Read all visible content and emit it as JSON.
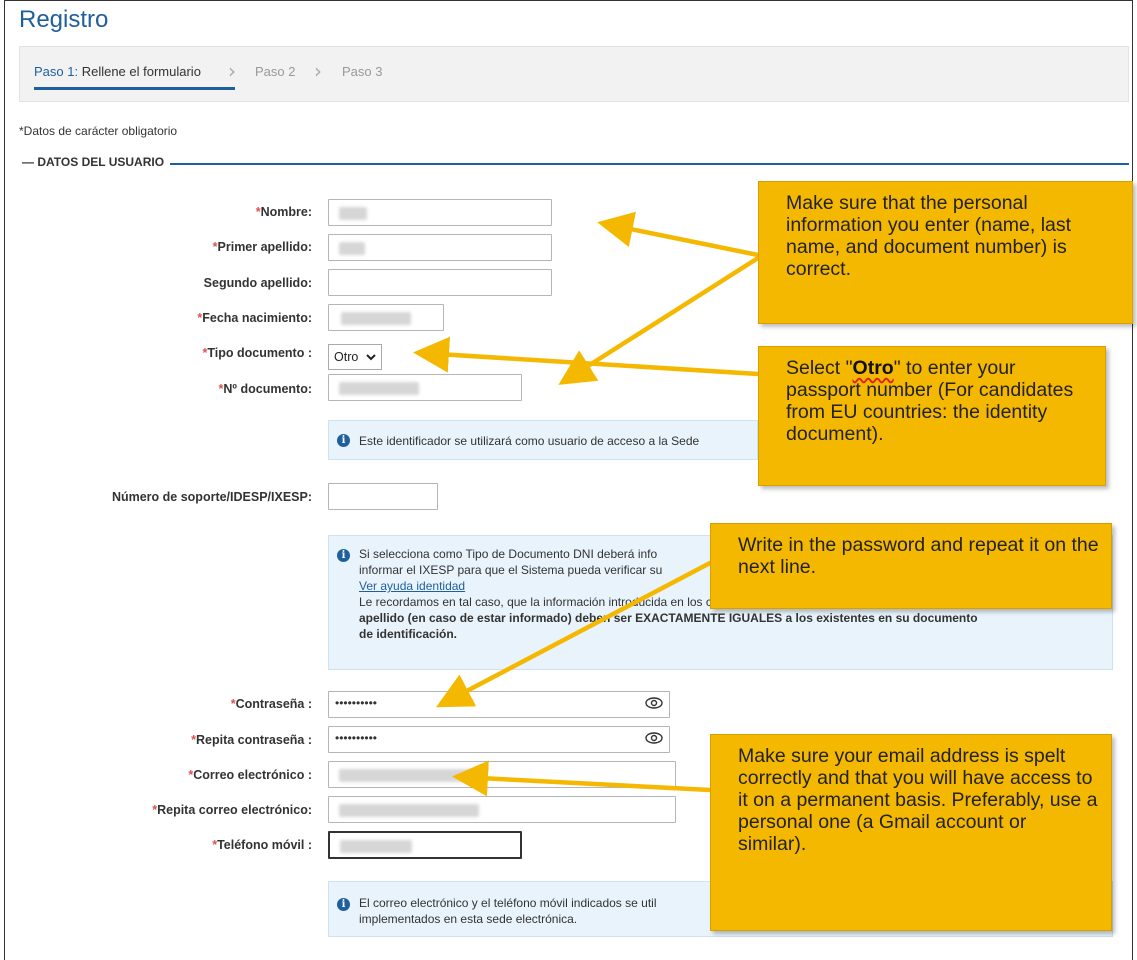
{
  "page": {
    "title": "Registro"
  },
  "stepper": {
    "step1_prefix": "Paso 1:",
    "step1_rest": " Rellene el formulario",
    "step2": "Paso 2",
    "step3": "Paso 3"
  },
  "required_note": "*Datos de carácter obligatorio",
  "section": {
    "legend": "DATOS DEL USUARIO"
  },
  "fields": {
    "nombre": "Nombre:",
    "primer_apellido": "Primer apellido:",
    "segundo_apellido": "Segundo apellido:",
    "fecha_nacimiento": "Fecha nacimiento:",
    "tipo_documento": "Tipo documento :",
    "tipo_documento_value": "Otro",
    "n_documento": "Nº documento:",
    "numero_soporte": "Número de soporte/IDESP/IXESP:",
    "contrasena": "Contraseña :",
    "contrasena_value": "••••••••••",
    "repita_contrasena": "Repita contraseña :",
    "repita_contrasena_value": "••••••••••",
    "correo": "Correo electrónico :",
    "repita_correo": "Repita correo electrónico:",
    "telefono": "Teléfono móvil :"
  },
  "info": {
    "identificador": "Este identificador se utilizará como usuario de acceso a la Sede",
    "dni_line1": "Si selecciona como Tipo de Documento DNI deberá info",
    "dni_line2": "informar el IXESP para que el Sistema pueda verificar su",
    "ayuda_link": "Ver ayuda identidad",
    "recordamos": "Le recordamos en tal caso, que la información introducida en los campos Nombre, Primer apellido y Segundo",
    "apellido_bold": "apellido (en caso de estar informado) deben ser EXACTAMENTE IGUALES a los existentes en su documento",
    "identificacion": "de identificación.",
    "correo_line1": "El correo electrónico y el teléfono móvil indicados se util",
    "correo_line2": "implementados en esta sede electrónica."
  },
  "callouts": {
    "personal": "Make sure that the personal information you enter (name, last name, and document number) is correct.",
    "otro_pre": "Select \"",
    "otro_word": "Otro",
    "otro_post": "\" to enter your passport number (For candidates from EU countries: the identity document).",
    "password": "Write in the password and repeat it on the next line.",
    "email": "Make sure your email address is spelt correctly and that you will have access to it on a permanent basis. Preferably, use a personal one (a Gmail account or similar)."
  },
  "colors": {
    "accent": "#1f5f9e",
    "callout": "#f5b800",
    "required": "#d9534f",
    "info_bg": "#e8f3fb"
  }
}
